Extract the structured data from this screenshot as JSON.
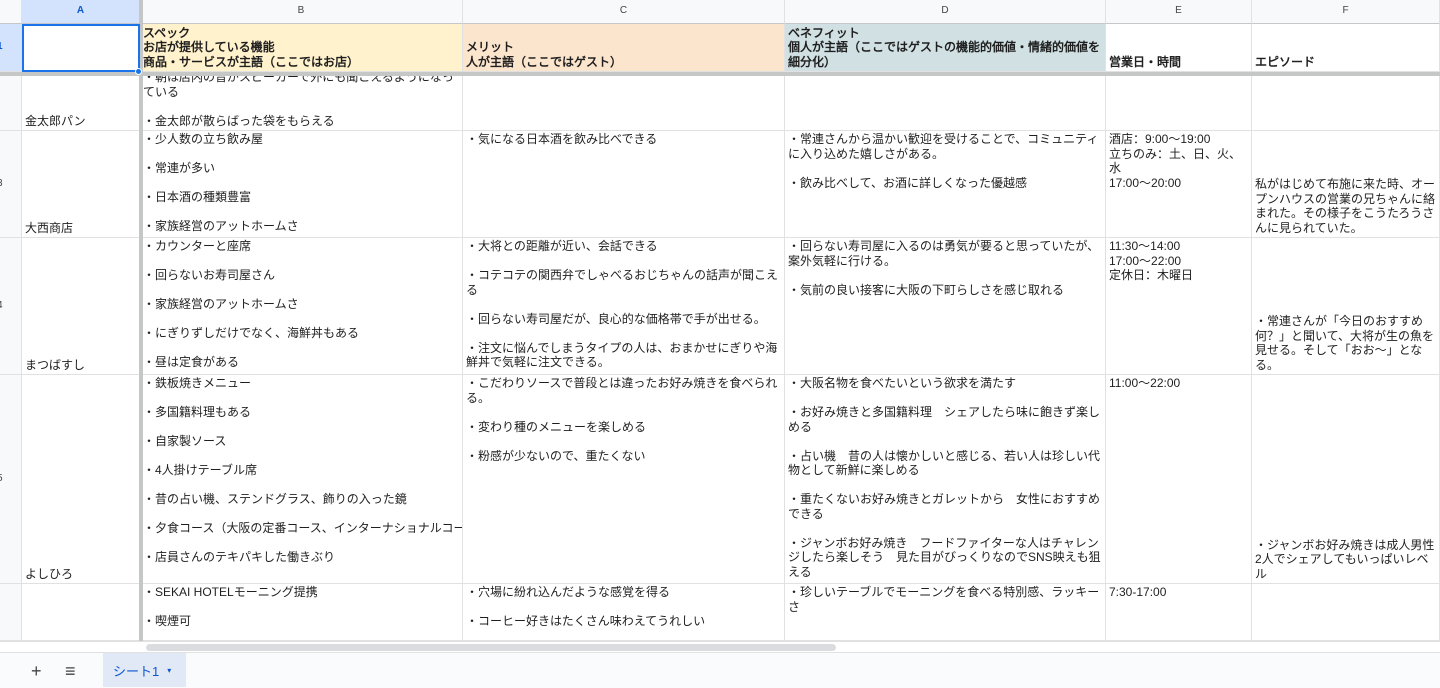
{
  "columns": [
    "A",
    "B",
    "C",
    "D",
    "E",
    "F"
  ],
  "row_numbers": {
    "r1": "1",
    "r2": "",
    "r3": "3",
    "r4": "4",
    "r5": "5",
    "r6": ""
  },
  "header_row": {
    "a": "",
    "b": "スペック\nお店が提供している機能\n商品・サービスが主語（ここではお店）",
    "c": "メリット\n人が主語（ここではゲスト）",
    "d": "ベネフィット\n個人が主語（ここではゲストの機能的価値・情緒的価値を細分化）",
    "e": "営業日・時間",
    "f": "エピソード"
  },
  "rows": [
    {
      "a": "金太郎パン",
      "b": "・朝は店内の音がスピーカーで外にも聞こえるようになっている\n\n・金太郎が散らばった袋をもらえる",
      "c": "",
      "d": "",
      "e": "",
      "f": ""
    },
    {
      "a": "大西商店",
      "b": "・少人数の立ち飲み屋\n\n・常連が多い\n\n・日本酒の種類豊富\n\n・家族経営のアットホームさ",
      "c": "・気になる日本酒を飲み比べできる",
      "d": "・常連さんから温かい歓迎を受けることで、コミュニティに入り込めた嬉しさがある。\n\n・飲み比べして、お酒に詳しくなった優越感",
      "e": "酒店：9:00～19:00\n立ちのみ：土、日、火、水\n17:00～20:00",
      "f": "私がはじめて布施に来た時、オープンハウスの営業の兄ちゃんに絡まれた。その様子をこうたろうさんに見られていた。"
    },
    {
      "a": "まつばすし",
      "b": "・カウンターと座席\n\n・回らないお寿司屋さん\n\n・家族経営のアットホームさ\n\n・にぎりずしだけでなく、海鮮丼もある\n\n・昼は定食がある",
      "c": "・大将との距離が近い、会話できる\n\n・コテコテの関西弁でしゃべるおじちゃんの話声が聞こえる\n\n・回らない寿司屋だが、良心的な価格帯で手が出せる。\n\n・注文に悩んでしまうタイプの人は、おまかせにぎりや海鮮丼で気軽に注文できる。",
      "d": "・回らない寿司屋に入るのは勇気が要ると思っていたが、案外気軽に行ける。\n\n・気前の良い接客に大阪の下町らしさを感じ取れる",
      "e": "11:30～14:00\n17:00～22:00\n定休日：木曜日",
      "f": "・常連さんが「今日のおすすめ何？」と聞いて、大将が生の魚を見せる。そして「おお～」となる。"
    },
    {
      "a": "よしひろ",
      "b": "・鉄板焼きメニュー\n\n・多国籍料理もある\n\n・自家製ソース\n\n・4人掛けテーブル席\n\n・昔の占い機、ステンドグラス、飾りの入った鏡\n\n・夕食コース（大阪の定番コース、インターナショナルコース）\n\n・店員さんのテキパキした働きぶり",
      "c": "・こだわりソースで普段とは違ったお好み焼きを食べられる。\n\n・変わり種のメニューを楽しめる\n\n・粉感が少ないので、重たくない",
      "d": "・大阪名物を食べたいという欲求を満たす\n\n・お好み焼きと多国籍料理　シェアしたら味に飽きず楽しめる\n\n・占い機　昔の人は懐かしいと感じる、若い人は珍しい代物として新鮮に楽しめる\n\n・重たくないお好み焼きとガレットから　女性におすすめできる\n\n・ジャンボお好み焼き　フードファイターな人はチャレンジしたら楽しそう　見た目がびっくりなのでSNS映えも狙える",
      "e": "11:00～22:00",
      "f": "・ジャンボお好み焼きは成人男性2人でシェアしてもいっぱいレベル"
    },
    {
      "a": "",
      "b": "・SEKAI HOTELモーニング提携\n\n・喫煙可",
      "c": "・穴場に紛れ込んだような感覚を得る\n\n・コーヒー好きはたくさん味わえてうれしい",
      "d": "・珍しいテーブルでモーニングを食べる特別感、ラッキーさ",
      "e": "7:30-17:00",
      "f": ""
    }
  ],
  "tabbar": {
    "add_label": "+",
    "menu_label": "≡",
    "sheet_tab": "シート1",
    "caret": "▾"
  },
  "colors": {
    "spec": "#fff2cc",
    "merit": "#fce5cd",
    "benefit": "#d0e0e3",
    "selection": "#1a73e8"
  }
}
